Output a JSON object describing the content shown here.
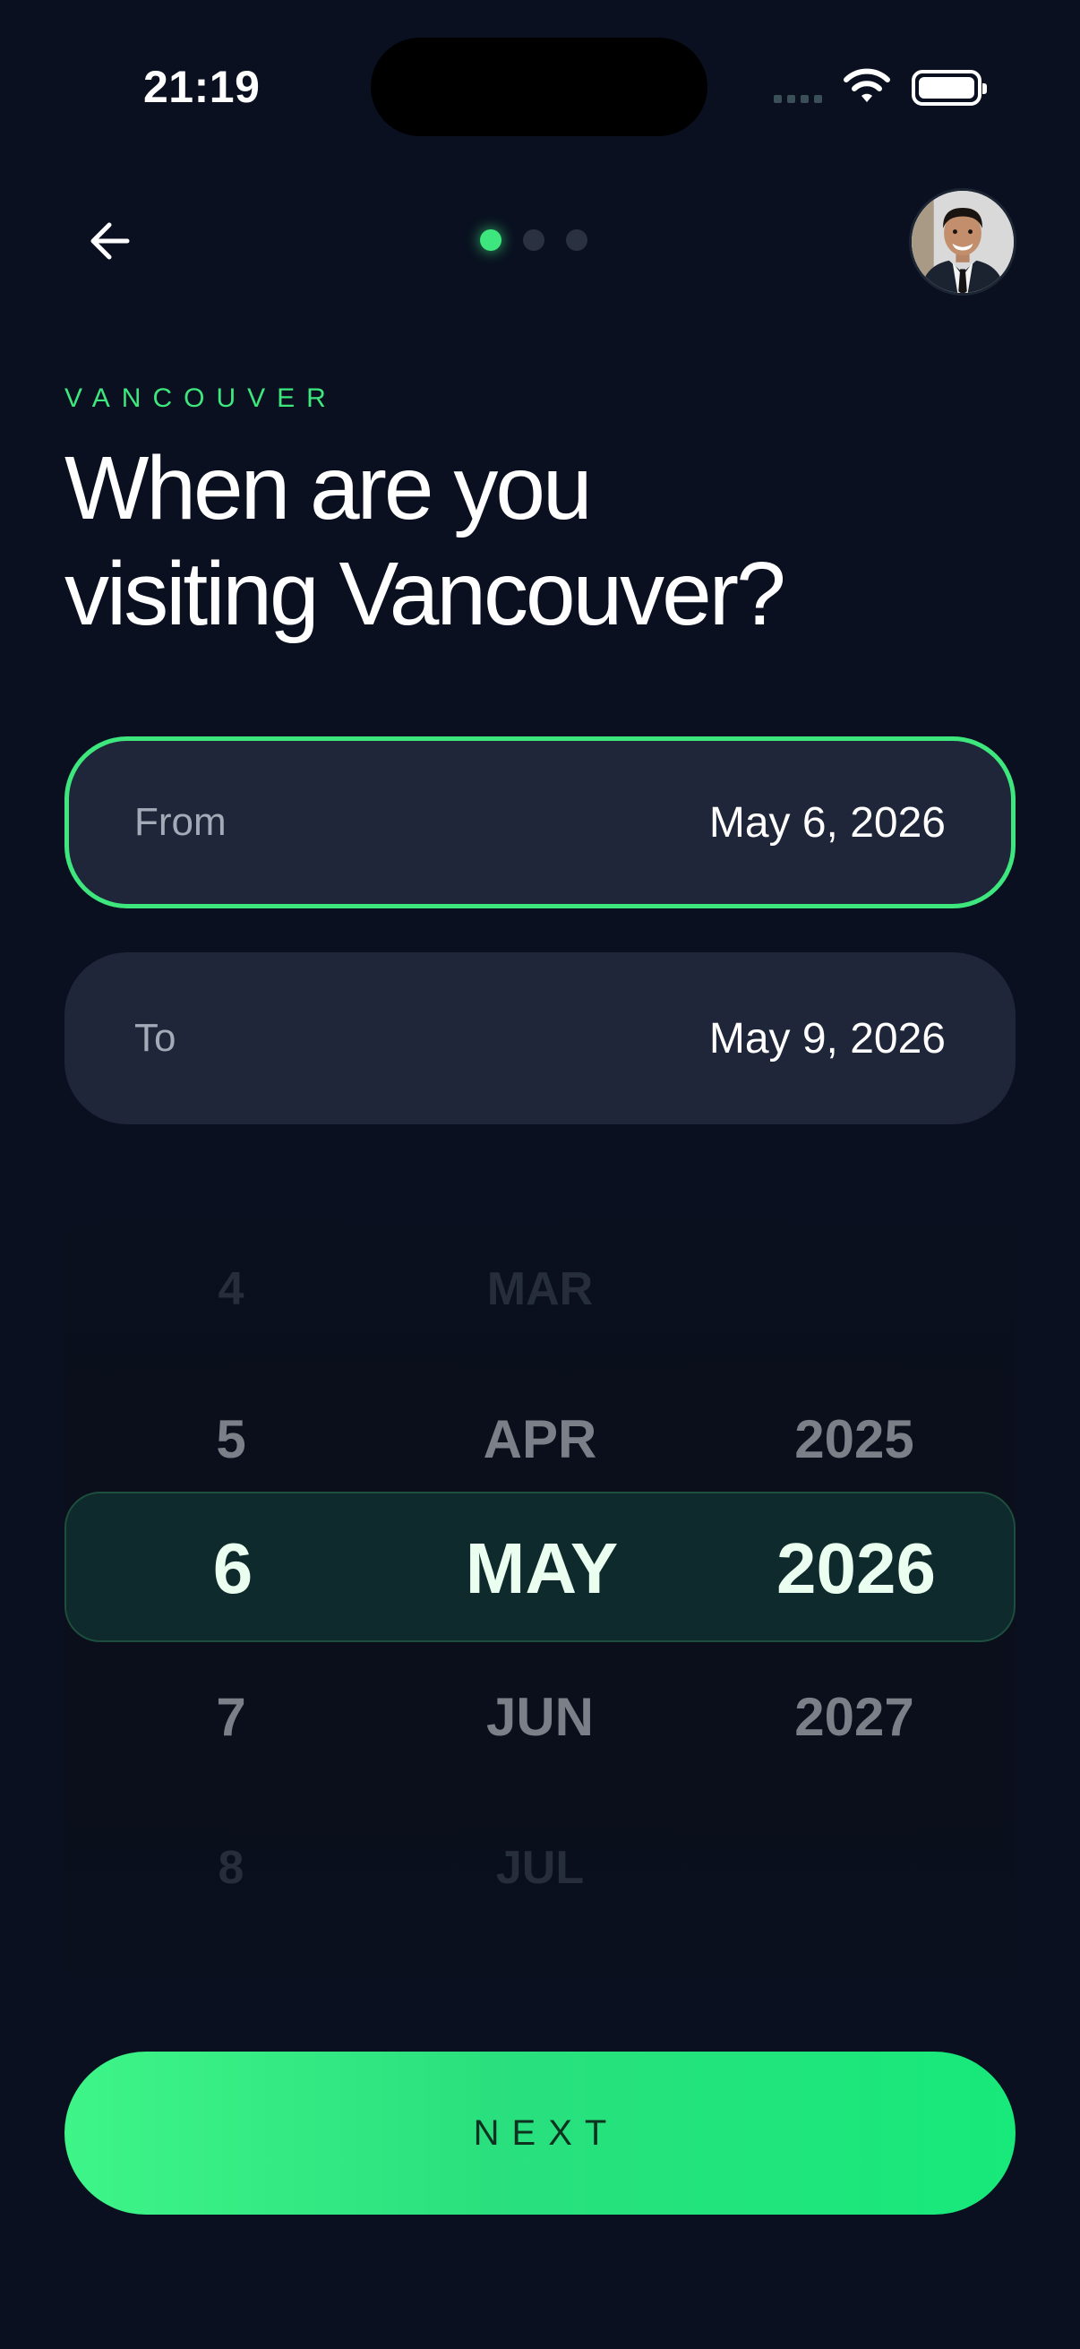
{
  "status_bar": {
    "time": "21:19"
  },
  "header": {
    "back_icon": "arrow-left-icon",
    "steps": {
      "total": 3,
      "current": 1
    },
    "accent_color": "#3ee77d"
  },
  "eyebrow": "VANCOUVER",
  "title": {
    "line1": "When are you",
    "line2": "visiting Vancouver?"
  },
  "fields": {
    "from": {
      "label": "From",
      "value": "May 6, 2026"
    },
    "to": {
      "label": "To",
      "value": "May 9, 2026"
    }
  },
  "picker": {
    "rows": [
      {
        "day": "4",
        "month": "MAR",
        "year": ""
      },
      {
        "day": "5",
        "month": "APR",
        "year": "2025"
      },
      {
        "day": "6",
        "month": "MAY",
        "year": "2026"
      },
      {
        "day": "7",
        "month": "JUN",
        "year": "2027"
      },
      {
        "day": "8",
        "month": "JUL",
        "year": ""
      }
    ]
  },
  "next_button": {
    "label": "NEXT"
  }
}
